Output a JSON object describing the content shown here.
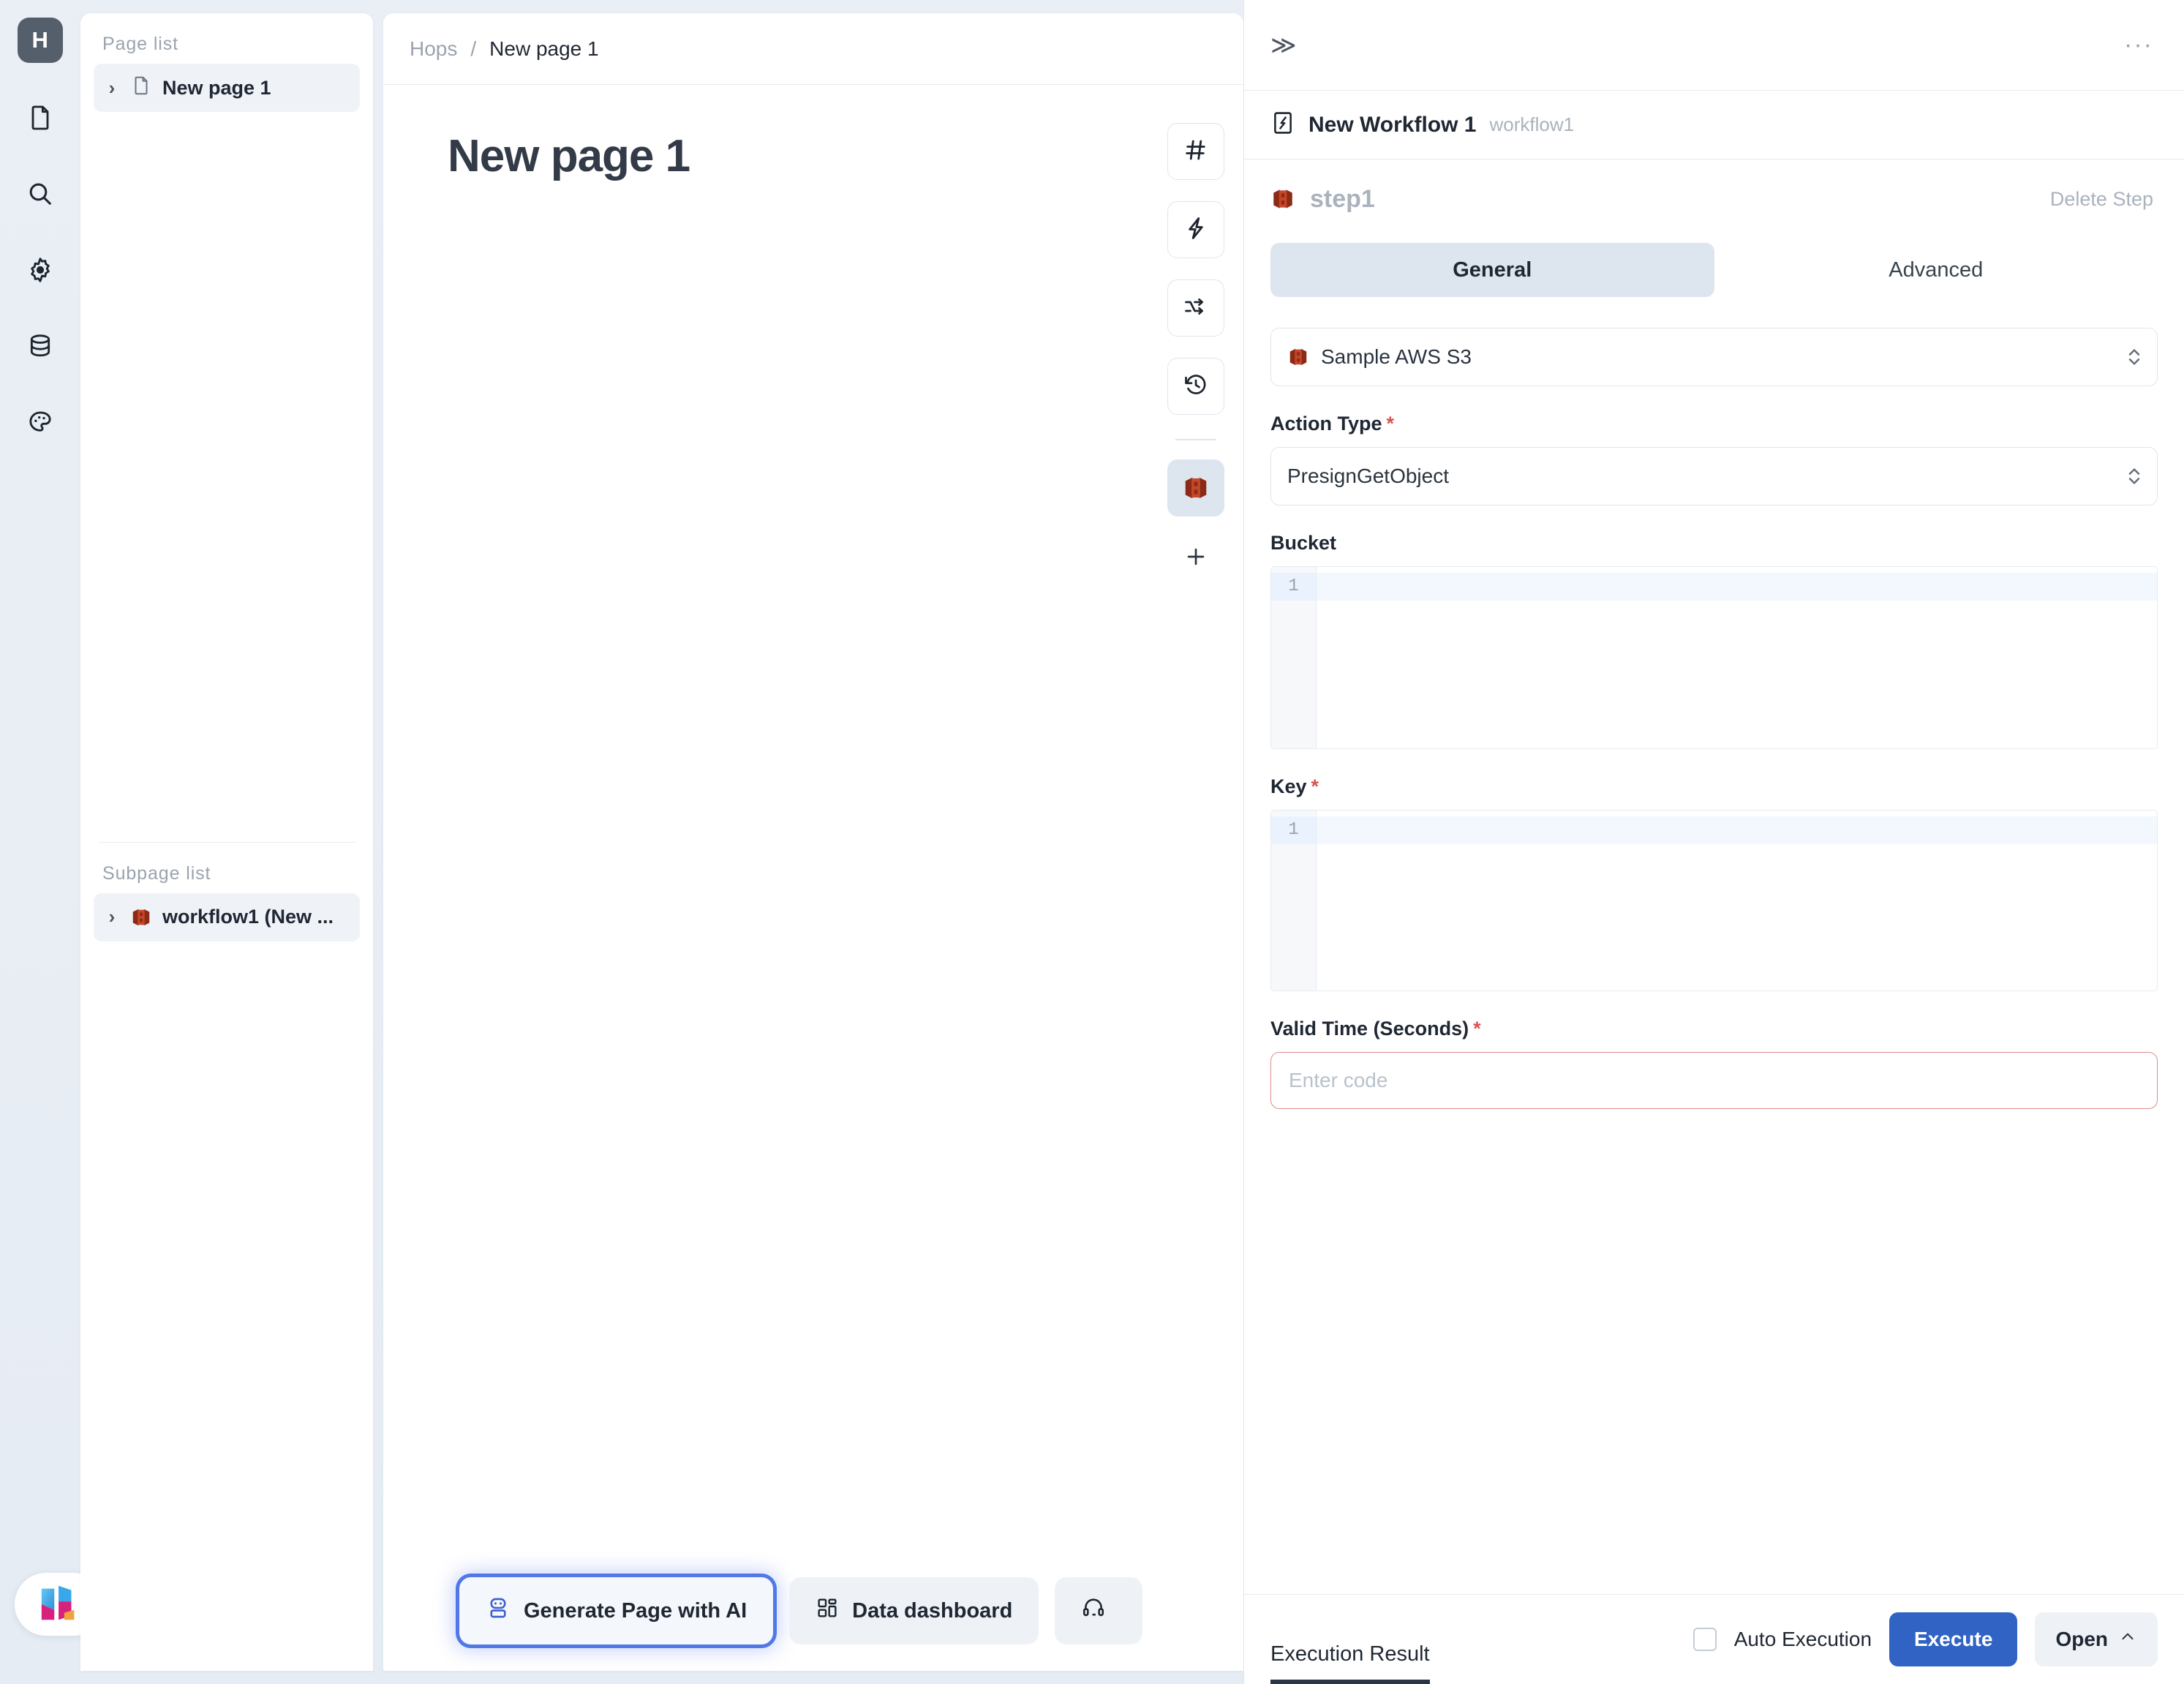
{
  "rail": {
    "logo_label": "H",
    "items": [
      {
        "name": "document-icon",
        "label": "Pages"
      },
      {
        "name": "search-icon",
        "label": "Search"
      },
      {
        "name": "gear-icon",
        "label": "Settings"
      },
      {
        "name": "database-icon",
        "label": "Resources"
      },
      {
        "name": "palette-icon",
        "label": "Theme"
      }
    ],
    "brand_logo": "hops-logo"
  },
  "pagelist": {
    "page_list_title": "Page list",
    "pages": [
      {
        "label": "New page 1",
        "icon": "file-icon",
        "selected": true
      }
    ],
    "subpage_list_title": "Subpage list",
    "subpages": [
      {
        "label": "workflow1 (New ...",
        "icon": "aws-s3-icon",
        "selected": true
      }
    ]
  },
  "center": {
    "breadcrumb": {
      "root": "Hops",
      "separator": "/",
      "current": "New page 1"
    },
    "canvas_title": "New page 1",
    "vtools": [
      {
        "name": "hash-icon",
        "label": "#",
        "active": false
      },
      {
        "name": "lightning-icon",
        "label": "Events",
        "active": false
      },
      {
        "name": "shuffle-icon",
        "label": "Flow",
        "active": false
      },
      {
        "name": "history-icon",
        "label": "History",
        "active": false
      },
      {
        "name": "aws-s3-icon",
        "label": "workflow1",
        "active": true
      }
    ],
    "add_button_label": "+",
    "bottom_buttons": [
      {
        "label": "Generate Page with AI",
        "icon": "robot-icon",
        "focused": true
      },
      {
        "label": "Data dashboard",
        "icon": "dashboard-icon",
        "focused": false
      },
      {
        "label": "",
        "icon": "support-headset-icon",
        "focused": false
      }
    ]
  },
  "right_panel": {
    "collapse_label": "≫",
    "more_label": "···",
    "workflow": {
      "name": "New Workflow 1",
      "id": "workflow1",
      "icon": "workflow-icon"
    },
    "step": {
      "name": "step1",
      "icon": "aws-s3-icon",
      "delete_label": "Delete Step"
    },
    "tabs": [
      {
        "label": "General",
        "active": true
      },
      {
        "label": "Advanced",
        "active": false
      }
    ],
    "resource": {
      "label": "Sample AWS S3",
      "icon": "aws-s3-icon"
    },
    "fields": [
      {
        "label": "Action Type",
        "required": true,
        "type": "select",
        "value": "PresignGetObject"
      },
      {
        "label": "Bucket",
        "required": false,
        "type": "code",
        "value": "",
        "line_number": "1"
      },
      {
        "label": "Key",
        "required": true,
        "type": "code",
        "value": "",
        "line_number": "1"
      },
      {
        "label": "Valid Time (Seconds)",
        "required": true,
        "type": "input",
        "value": "",
        "placeholder": "Enter code",
        "error": true
      }
    ],
    "footer": {
      "execution_result_tab": "Execution Result",
      "auto_execution_label": "Auto Execution",
      "auto_execution_checked": false,
      "execute_label": "Execute",
      "open_label": "Open"
    }
  },
  "colors": {
    "accent_blue": "#3163c4",
    "focus_blue": "#5078e6",
    "error_red": "#d9534f",
    "aws_s3_red": "#b4361f",
    "muted_text": "#aab2bd",
    "panel_bg": "#ffffff",
    "app_bg": "#e8edf3"
  }
}
